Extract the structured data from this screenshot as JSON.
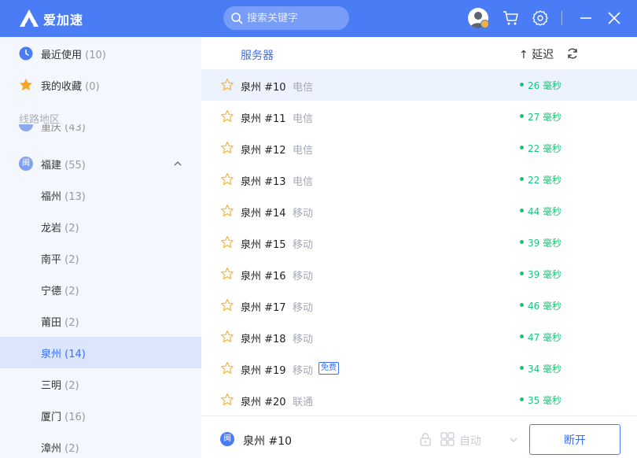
{
  "app": {
    "name": "爱加速"
  },
  "search": {
    "placeholder": "搜索关键字"
  },
  "colors": {
    "accent": "#4a7cf6",
    "latency_ok": "#18c57a",
    "star": "#f6b33c"
  },
  "sidebar": {
    "quick": [
      {
        "label": "最近使用",
        "count": "(10)",
        "icon": "clock-icon"
      },
      {
        "label": "我的收藏",
        "count": "(0)",
        "icon": "star-filled-icon"
      }
    ],
    "section_title": "线路地区",
    "partial_region": {
      "label": "重庆",
      "count": "(43)"
    },
    "region": {
      "label": "福建",
      "count": "(55)",
      "icon_char": "闽"
    },
    "cities": [
      {
        "label": "福州",
        "count": "(13)"
      },
      {
        "label": "龙岩",
        "count": "(2)"
      },
      {
        "label": "南平",
        "count": "(2)"
      },
      {
        "label": "宁德",
        "count": "(2)"
      },
      {
        "label": "莆田",
        "count": "(2)"
      },
      {
        "label": "泉州",
        "count": "(14)",
        "active": true
      },
      {
        "label": "三明",
        "count": "(2)"
      },
      {
        "label": "厦门",
        "count": "(16)"
      },
      {
        "label": "漳州",
        "count": "(2)"
      }
    ]
  },
  "table": {
    "col_server": "服务器",
    "col_latency": "↑ 延迟",
    "rows": [
      {
        "name": "泉州 #10",
        "isp": "电信",
        "latency": "26 毫秒",
        "selected": true
      },
      {
        "name": "泉州 #11",
        "isp": "电信",
        "latency": "27 毫秒"
      },
      {
        "name": "泉州 #12",
        "isp": "电信",
        "latency": "22 毫秒"
      },
      {
        "name": "泉州 #13",
        "isp": "电信",
        "latency": "22 毫秒"
      },
      {
        "name": "泉州 #14",
        "isp": "移动",
        "latency": "44 毫秒"
      },
      {
        "name": "泉州 #15",
        "isp": "移动",
        "latency": "39 毫秒"
      },
      {
        "name": "泉州 #16",
        "isp": "移动",
        "latency": "39 毫秒"
      },
      {
        "name": "泉州 #17",
        "isp": "移动",
        "latency": "46 毫秒"
      },
      {
        "name": "泉州 #18",
        "isp": "移动",
        "latency": "47 毫秒"
      },
      {
        "name": "泉州 #19",
        "isp": "移动",
        "latency": "34 毫秒",
        "badge": "免费"
      },
      {
        "name": "泉州 #20",
        "isp": "联通",
        "latency": "35 毫秒"
      }
    ]
  },
  "bottom": {
    "region_char": "闽",
    "current": "泉州 #10",
    "mode": "自动",
    "disconnect": "断开"
  }
}
